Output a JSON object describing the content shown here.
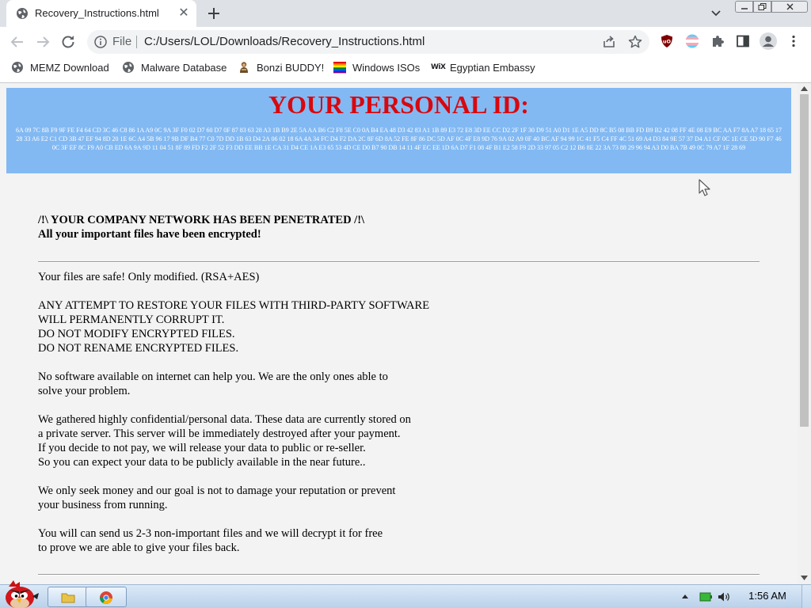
{
  "browser": {
    "tab_title": "Recovery_Instructions.html",
    "tab_close": "✕",
    "file_label": "File",
    "url": "C:/Users/LOL/Downloads/Recovery_Instructions.html"
  },
  "bookmarks": [
    {
      "label": "MEMZ Download",
      "icon": "globe-icon"
    },
    {
      "label": "Malware Database",
      "icon": "globe-icon"
    },
    {
      "label": "Bonzi BUDDY!",
      "icon": "bonzi-icon"
    },
    {
      "label": "Windows ISOs",
      "icon": "rainbow-flag-icon"
    },
    {
      "label": "Egyptian Embassy",
      "icon": "wix-icon",
      "icon_text": "WiX"
    }
  ],
  "page": {
    "id_title": "YOUR PERSONAL ID:",
    "id_code": "6A 09 7C 8B F9 9F FE F4 64 CD 3C 46 C8 86 1A A9 0C 9A 3F F0 02 D7 60 D7 0F 87 83 63 28 A3 1B B9 2E 5A AA B6 C2 F8 5E C0 0A B4 EA 48 D3 42 83 A1 1B 89 E3 72 E8 3D EE CC D2 2F 1F 30 D9 51 A0 D1 1E A5 DD 8C B5 08 BB FD B9 B2 42 08 FF 4E 08 E9 BC AA F7 8A A7 18 65 17 28 33 A6 E2 C1 CD 3B 47 EF 94 8D 20 1E 6C A4 5B 96 17 9B DF B4 77 C0 7D DD 1B 63 D4 2A 06 02 18 6A 4A 34 FC D4 F2 DA 2C 8F 6D 8A 52 FE 8F 86 DC 5D AF 0C 4F E8 9D 76 9A 02 A9 0F 40 BC AF 94 99 1C 41 F5 C4 FF 4C 51 69 A4 D3 84 9E 57 37 D4 A1 CF 0C 1E CE 5D 90 F7 46 0C 3F EF 8C F9 A0 CB ED 6A 9A 9D 11 04 51 8F 89 FD F2 2F 52 F3 DD EE BB 1E CA 31 D4 CE 1A E3 65 53 4D CE D0 B7 90 DB 14 11 4F EC EE 1D 6A D7 F1 08 4F B1 E2 58 F9 2D 33 97 05 C2 12 B6 8E 22 3A 73 88 29 96 94 A3 D0 BA 7B 49 0C 79 A7 1F 28 69",
    "headline_1": "/!\\ YOUR COMPANY NETWORK HAS BEEN PENETRATED /!\\",
    "headline_2": "All your important files have been encrypted!",
    "lines": [
      "Your files are safe! Only modified. (RSA+AES)",
      "ANY ATTEMPT TO RESTORE YOUR FILES WITH THIRD-PARTY SOFTWARE",
      "WILL PERMANENTLY CORRUPT IT.",
      "DO NOT MODIFY ENCRYPTED FILES.",
      "DO NOT RENAME ENCRYPTED FILES.",
      "No software available on internet can help you. We are the only ones able to",
      "solve your problem.",
      "We gathered highly confidential/personal data. These data are currently stored on",
      "a private server. This server will be immediately destroyed after your payment.",
      "If you decide to not pay, we will release your data to public or re-seller.",
      "So you can expect your data to be publicly available in the near future..",
      "We only seek money and our goal is not to damage your reputation or prevent",
      "your business from running.",
      "You will can send us 2-3 non-important files and we will decrypt it for free",
      "to prove we are able to give your files back."
    ]
  },
  "taskbar": {
    "clock": "1:56 AM"
  },
  "colors": {
    "id_banner": "#82b9f3",
    "id_title": "#d8080e",
    "page_bg": "#f3f3f3"
  }
}
